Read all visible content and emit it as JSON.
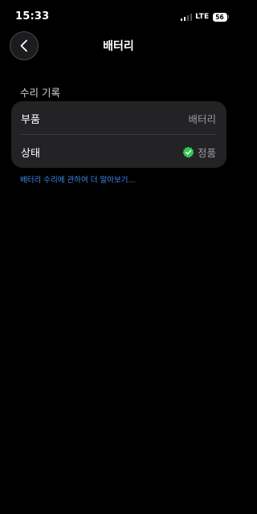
{
  "status_bar": {
    "time": "15:33",
    "network": "LTE",
    "battery_level": "56"
  },
  "nav": {
    "title": "배터리",
    "back_icon": "chevron-left-icon"
  },
  "section": {
    "header": "수리 기록",
    "rows": [
      {
        "label": "부품",
        "value": "배터리"
      },
      {
        "label": "상태",
        "value": "정품",
        "icon": "verified-check-icon",
        "icon_color": "#34c759"
      }
    ]
  },
  "learn_more_link": "배터리 수리에 관하여 더 알아보기...",
  "colors": {
    "background": "#000000",
    "card": "#232326",
    "link": "#3b8ef5",
    "verified": "#34c759"
  }
}
